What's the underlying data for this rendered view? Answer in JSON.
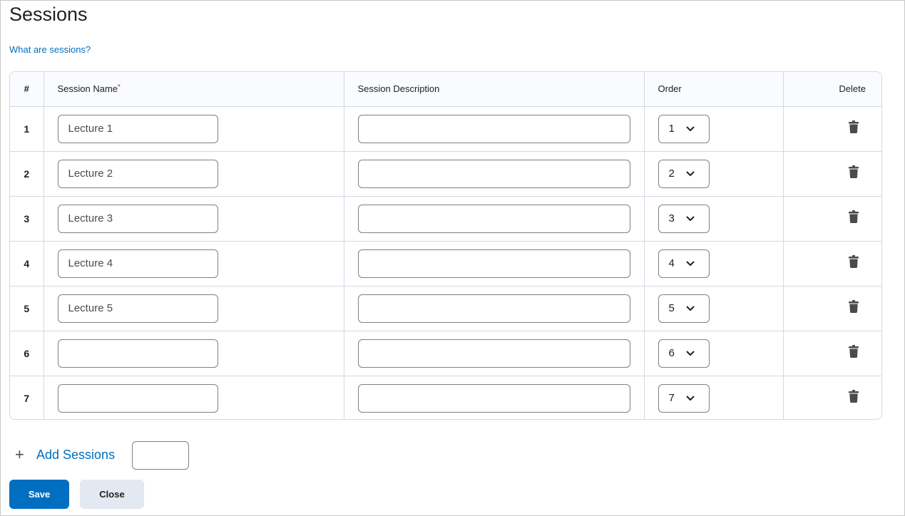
{
  "page": {
    "title": "Sessions",
    "help_link": "What are sessions?"
  },
  "table": {
    "headers": {
      "number": "#",
      "name": "Session Name",
      "name_required_marker": "*",
      "description": "Session Description",
      "order": "Order",
      "delete": "Delete"
    },
    "rows": [
      {
        "number": "1",
        "name": "Lecture 1",
        "description": "",
        "order": "1"
      },
      {
        "number": "2",
        "name": "Lecture 2",
        "description": "",
        "order": "2"
      },
      {
        "number": "3",
        "name": "Lecture 3",
        "description": "",
        "order": "3"
      },
      {
        "number": "4",
        "name": "Lecture 4",
        "description": "",
        "order": "4"
      },
      {
        "number": "5",
        "name": "Lecture 5",
        "description": "",
        "order": "5"
      },
      {
        "number": "6",
        "name": "",
        "description": "",
        "order": "6"
      },
      {
        "number": "7",
        "name": "",
        "description": "",
        "order": "7"
      }
    ]
  },
  "add_sessions": {
    "icon": "plus-icon",
    "plus_glyph": "+",
    "label": "Add Sessions",
    "count_value": ""
  },
  "actions": {
    "save_label": "Save",
    "close_label": "Close"
  },
  "colors": {
    "link": "#006fbf",
    "primary_button": "#006fbf",
    "secondary_button": "#e3e9f1",
    "required": "#cd2026",
    "border": "#d3d9e3"
  }
}
